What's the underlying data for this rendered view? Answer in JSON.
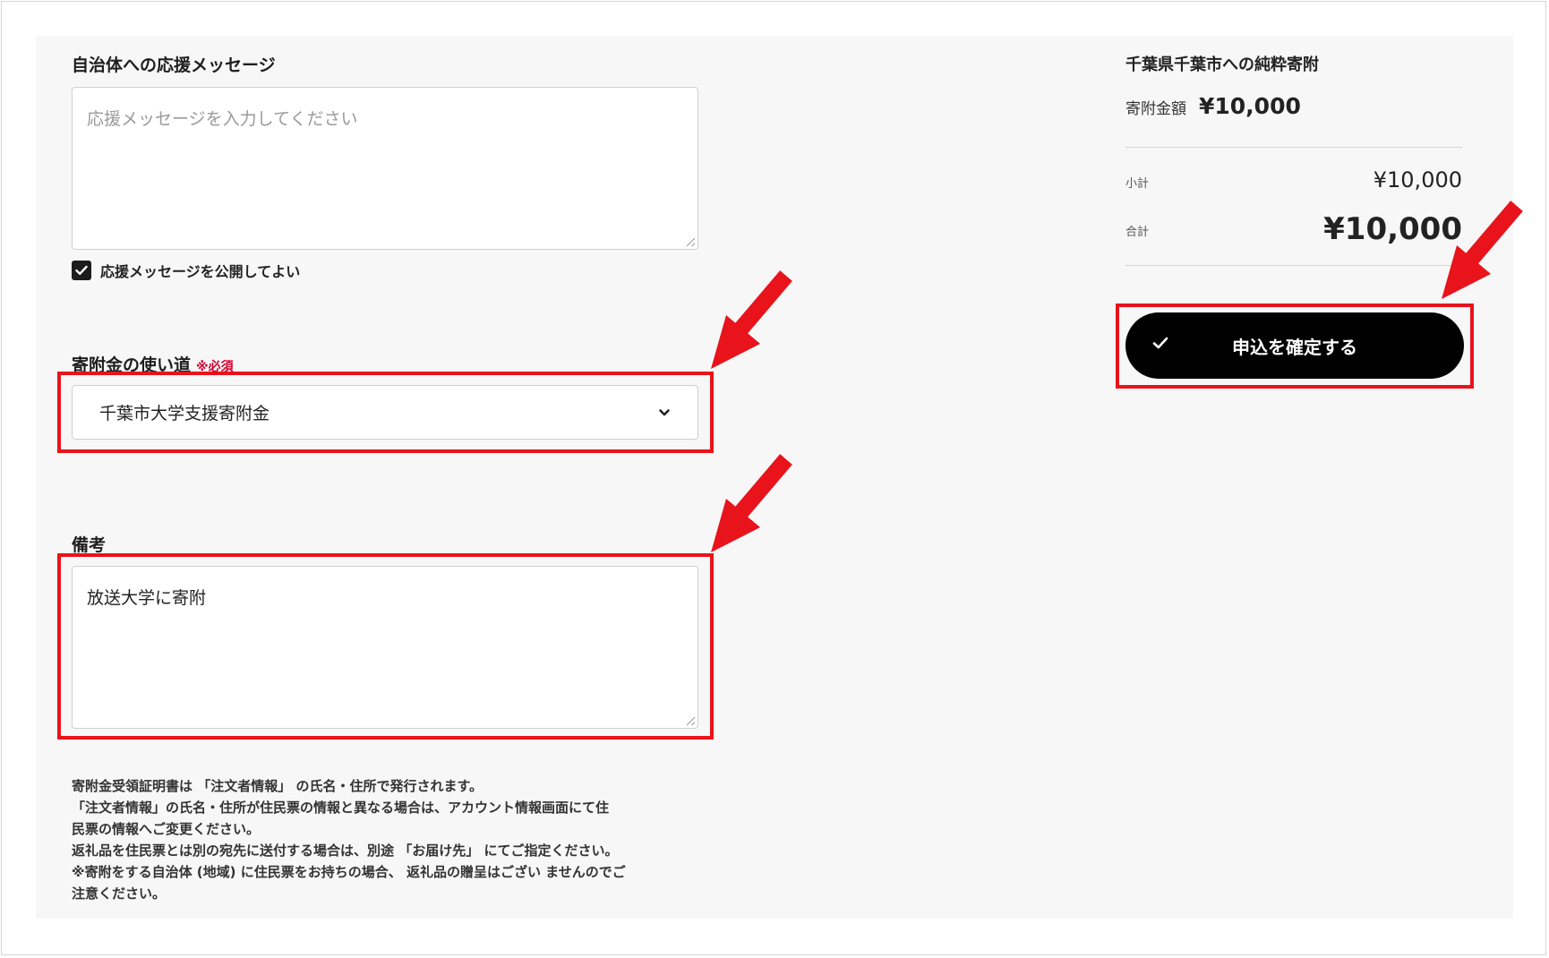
{
  "message": {
    "heading": "自治体への応援メッセージ",
    "placeholder": "応援メッセージを入力してください",
    "publish_label": "応援メッセージを公開してよい"
  },
  "usage": {
    "heading": "寄附金の使い道",
    "required": "※必須",
    "selected": "千葉市大学支援寄附金"
  },
  "remarks": {
    "heading": "備考",
    "value": "放送大学に寄附"
  },
  "notes": [
    "寄附金受領証明書は 「注文者情報」 の氏名・住所で発行されます。",
    "「注文者情報」の氏名・住所が住民票の情報と異なる場合は、アカウント情報画面にて住",
    "民票の情報へご変更ください。",
    "返礼品を住民票とは別の宛先に送付する場合は、別途 「お届け先」 にてご指定ください。",
    "※寄附をする自治体 (地域) に住民票をお持ちの場合、 返礼品の贈呈はござい ませんのでご",
    "注意ください。"
  ],
  "summary": {
    "title": "千葉県千葉市への純粋寄附",
    "amount_label": "寄附金額",
    "amount_value": "¥10,000",
    "subtotal_label": "小計",
    "subtotal_value": "¥10,000",
    "total_label": "合計",
    "total_value": "¥10,000",
    "submit_label": "申込を確定する"
  },
  "colors": {
    "highlight": "#e8131b",
    "required": "#d5002f",
    "button": "#000000"
  },
  "icons": [
    "check-icon",
    "chevron-down-icon",
    "arrow-icon"
  ]
}
